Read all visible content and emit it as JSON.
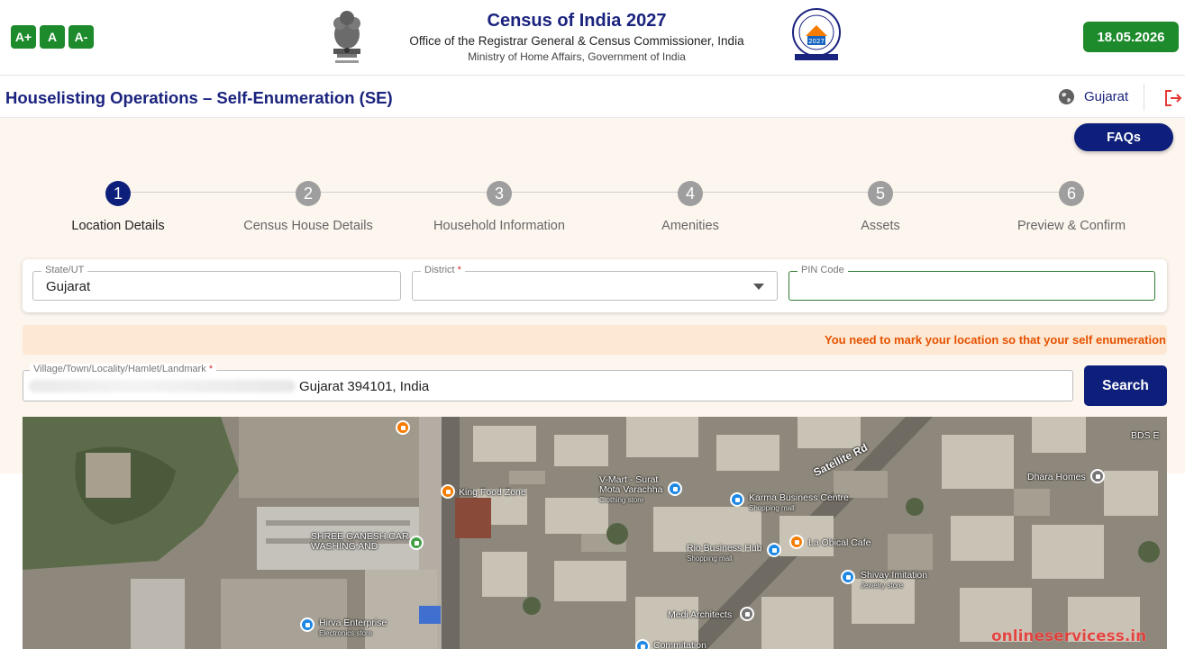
{
  "header": {
    "font_controls": [
      "A+",
      "A",
      "A-"
    ],
    "title": "Census of India 2027",
    "subtitle": "Office of the Registrar General & Census Commissioner, India",
    "ministry": "Ministry of Home Affairs, Government of India",
    "emblem_icon": "national-emblem-icon",
    "census_logo_text": "2027",
    "date": "18.05.2026",
    "accent": "#1d8a2c"
  },
  "subheader": {
    "title": "Houselisting Operations – Self-Enumeration (SE)",
    "state": "Gujarat",
    "globe_icon": "globe-icon",
    "logout_icon": "logout-icon"
  },
  "faq_label": "FAQs",
  "stepper": {
    "active_step": 1,
    "steps": [
      {
        "num": "1",
        "label": "Location Details"
      },
      {
        "num": "2",
        "label": "Census House Details"
      },
      {
        "num": "3",
        "label": "Household Information"
      },
      {
        "num": "4",
        "label": "Amenities"
      },
      {
        "num": "5",
        "label": "Assets"
      },
      {
        "num": "6",
        "label": "Preview & Confirm"
      }
    ]
  },
  "form": {
    "state_label": "State/UT",
    "state_value": "Gujarat",
    "district_label": "District",
    "district_value": "",
    "pin_label": "PIN Code",
    "pin_value": ""
  },
  "warning": "You need to mark your location so that your self enumeration i",
  "village": {
    "label": "Village/Town/Locality/Hamlet/Landmark",
    "value": "Gujarat 394101, India",
    "search_label": "Search"
  },
  "map": {
    "places": [
      {
        "name": "King Food Zone",
        "sub": ""
      },
      {
        "name": "V-Mart - Surat Mota Varachha",
        "sub": "Clothing store"
      },
      {
        "name": "Karma Business Centre",
        "sub": "Shopping mall"
      },
      {
        "name": "Dhara Homes",
        "sub": ""
      },
      {
        "name": "SHREE GANESH CAR WASHING AND",
        "sub": ""
      },
      {
        "name": "Rio Business Hub",
        "sub": "Shopping mall"
      },
      {
        "name": "La Obical Cafe",
        "sub": ""
      },
      {
        "name": "Shivay Imitation",
        "sub": "Jewelry store"
      },
      {
        "name": "Medi Architects",
        "sub": ""
      },
      {
        "name": "Hirva Enterprise",
        "sub": "Electronics store"
      },
      {
        "name": "BDS E",
        "sub": ""
      },
      {
        "name": "Commitation",
        "sub": ""
      }
    ],
    "road": "Satellite Rd"
  },
  "watermark": "onlineservicess.in"
}
